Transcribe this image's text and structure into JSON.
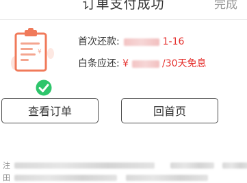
{
  "nav": {
    "title": "订单支付成功",
    "done_label": "完成"
  },
  "repayment": {
    "first_label": "首次还款:",
    "first_value_tail": "1-16",
    "due_label": "白条应还:",
    "due_value_prefix": "¥",
    "due_value_tail": "/30天免息"
  },
  "actions": {
    "view_order_label": "查看订单",
    "home_label": "回首页"
  },
  "notes": {
    "line1_lead": "注",
    "line2_lead": "田"
  },
  "colors": {
    "accent_red": "#e5302d",
    "icon_orange": "#f07a5a",
    "check_green": "#2ec56b"
  },
  "icons": [
    "order-clipboard-icon",
    "check-badge-icon"
  ]
}
